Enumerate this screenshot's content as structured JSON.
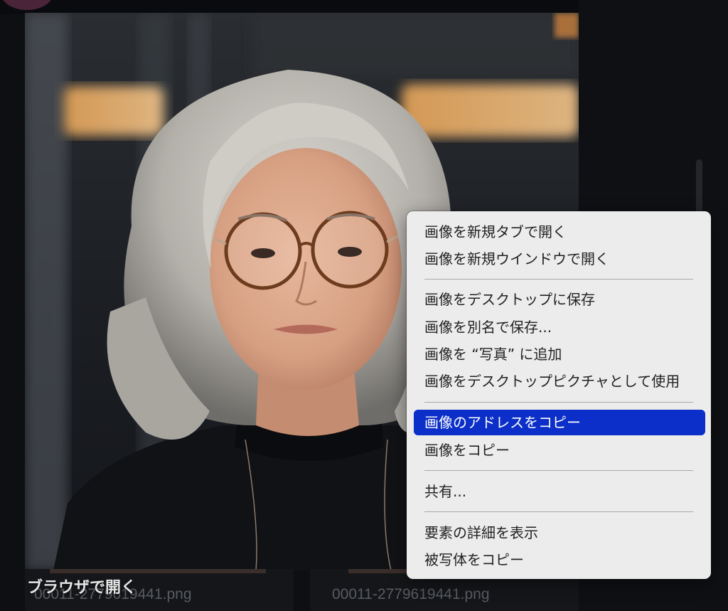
{
  "context_menu": {
    "items": [
      {
        "label": "画像を新規タブで開く"
      },
      {
        "label": "画像を新規ウインドウで開く"
      },
      {
        "label": "画像をデスクトップに保存"
      },
      {
        "label": "画像を別名で保存..."
      },
      {
        "label": "画像を “写真” に追加"
      },
      {
        "label": "画像をデスクトップピクチャとして使用"
      },
      {
        "label": "画像のアドレスをコピー"
      },
      {
        "label": "画像をコピー"
      },
      {
        "label": "共有..."
      },
      {
        "label": "要素の詳細を表示"
      },
      {
        "label": "被写体をコピー"
      }
    ],
    "highlighted_label": "画像のアドレスをコピー",
    "highlight_color": "#0b2fc8"
  },
  "gallery": {
    "overlay_action": "ブラウザで開く",
    "files": [
      {
        "name": "00011-2779619441.png"
      },
      {
        "name": "00011-2779619441.png"
      }
    ]
  },
  "icons": {
    "avatar": "avatar-icon"
  }
}
